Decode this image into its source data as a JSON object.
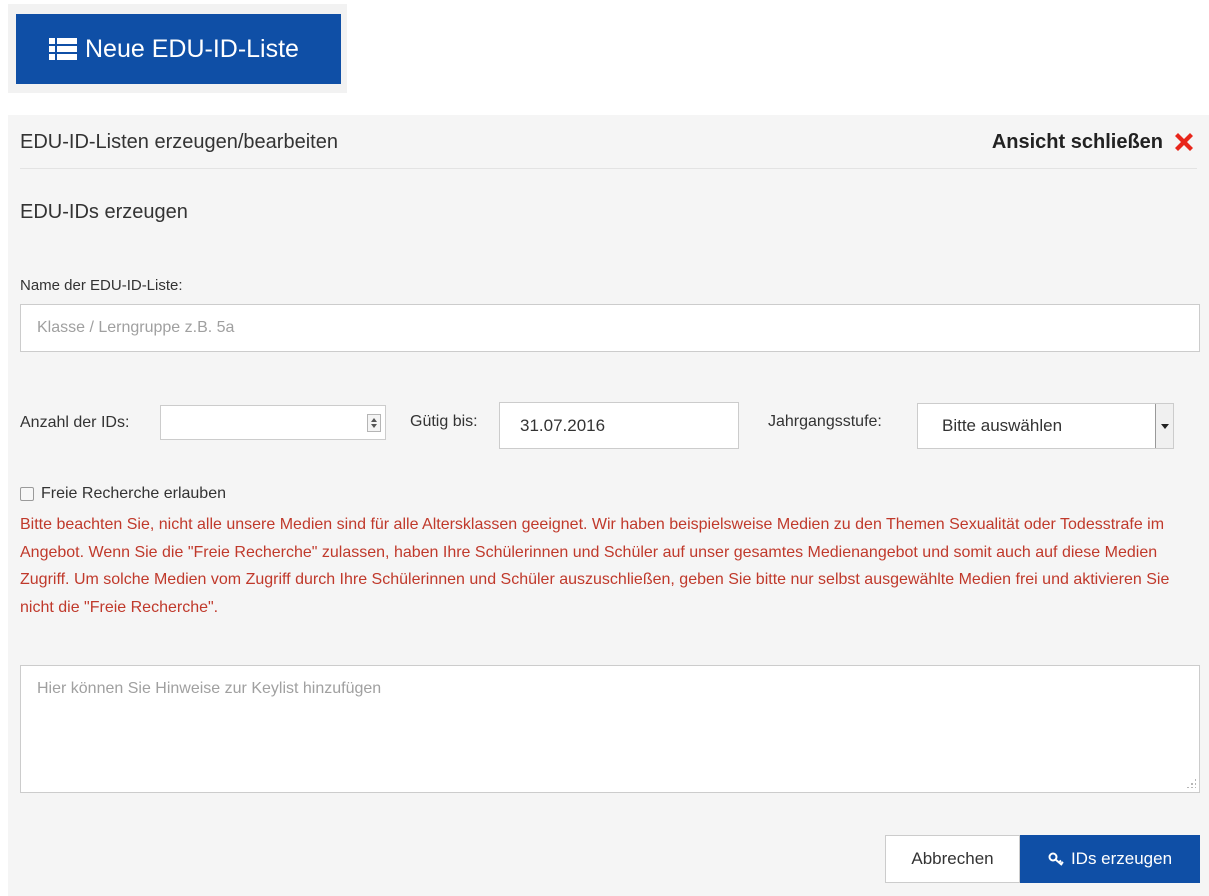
{
  "top_button": {
    "label": "Neue EDU-ID-Liste",
    "icon": "list-icon"
  },
  "panel": {
    "title": "EDU-ID-Listen erzeugen/bearbeiten",
    "close_label": "Ansicht schließen",
    "close_icon": "close-icon",
    "close_color": "#e8261b"
  },
  "form": {
    "section_title": "EDU-IDs erzeugen",
    "name_label": "Name der EDU-ID-Liste:",
    "name_placeholder": "Klasse / Lerngruppe z.B. 5a",
    "name_value": "",
    "count_label": "Anzahl der IDs:",
    "count_value": "",
    "valid_label": "Gütig bis:",
    "valid_value": "31.07.2016",
    "grade_label": "Jahrgangsstufe:",
    "grade_selected": "Bitte auswählen",
    "free_search_label": "Freie Recherche erlauben",
    "free_search_checked": false,
    "warning_text": "Bitte beachten Sie, nicht alle unsere Medien sind für alle Altersklassen geeignet. Wir haben beispielsweise Medien zu den Themen Sexualität oder Todesstrafe im Angebot. Wenn Sie die \"Freie Recherche\" zulassen, haben Ihre Schülerinnen und Schüler auf unser gesamtes Medienangebot und somit auch auf diese Medien Zugriff. Um solche Medien vom Zugriff durch Ihre Schülerinnen und Schüler auszuschließen, geben Sie bitte nur selbst ausgewählte Medien frei und aktivieren Sie nicht die \"Freie Recherche\".",
    "warning_color": "#c0392b",
    "notes_placeholder": "Hier können Sie Hinweise zur Keylist hinzufügen"
  },
  "actions": {
    "cancel_label": "Abbrechen",
    "create_label": "IDs erzeugen",
    "create_icon": "key-icon",
    "primary_color": "#0f4fa6"
  }
}
